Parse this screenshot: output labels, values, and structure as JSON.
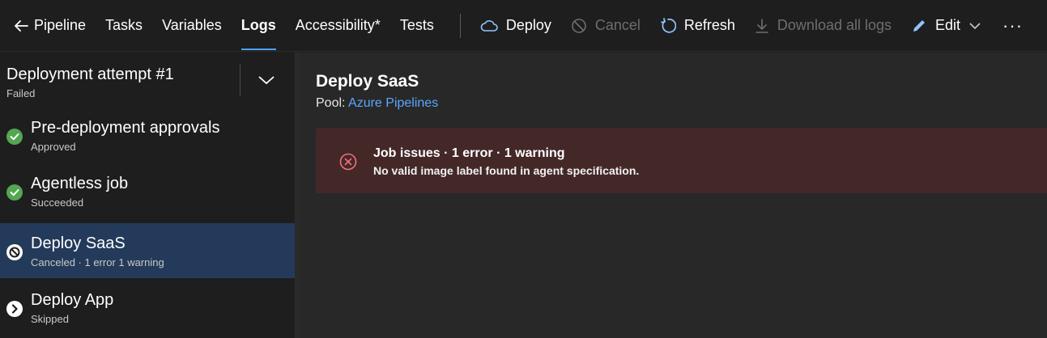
{
  "nav": {
    "back_label": "Pipeline",
    "tabs": [
      {
        "label": "Tasks"
      },
      {
        "label": "Variables"
      },
      {
        "label": "Logs",
        "active": true
      },
      {
        "label": "Accessibility*"
      },
      {
        "label": "Tests"
      }
    ]
  },
  "actions": {
    "deploy": "Deploy",
    "cancel": "Cancel",
    "refresh": "Refresh",
    "download": "Download all logs",
    "edit": "Edit",
    "more": "···"
  },
  "attempt": {
    "title": "Deployment attempt #1",
    "status": "Failed"
  },
  "stages": [
    {
      "name": "Pre-deployment approvals",
      "status": "Approved",
      "icon": "check-circle-icon"
    },
    {
      "name": "Agentless job",
      "status": "Succeeded",
      "icon": "check-circle-icon"
    },
    {
      "name": "Deploy SaaS",
      "status": "Canceled · 1 error 1 warning",
      "icon": "canceled-icon",
      "selected": true
    },
    {
      "name": "Deploy App",
      "status": "Skipped",
      "icon": "skipped-icon"
    }
  ],
  "job": {
    "title": "Deploy SaaS",
    "pool_label": "Pool:",
    "pool_value": "Azure Pipelines"
  },
  "issues": {
    "title": "Job issues · 1 error · 1 warning",
    "message": "No valid image label found in agent specification."
  },
  "colors": {
    "accent": "#4ea1f3",
    "success": "#54a653",
    "error": "#f1707b",
    "selected_bg": "#243a5a",
    "error_bg": "#442828"
  }
}
